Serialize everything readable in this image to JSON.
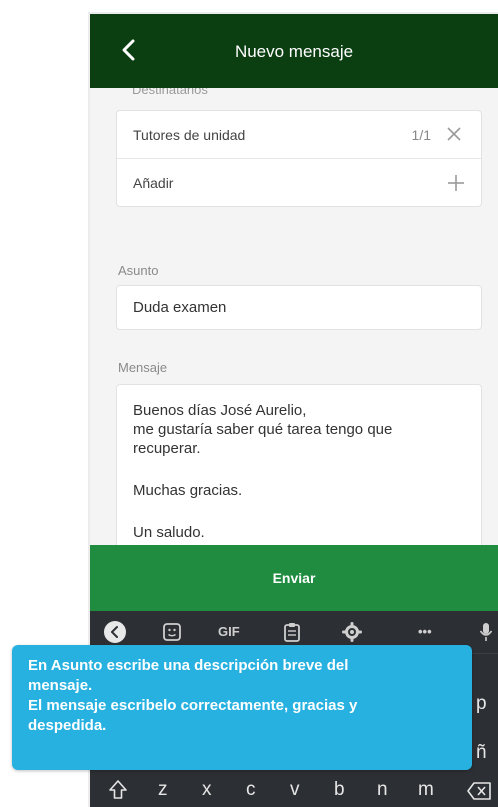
{
  "header": {
    "title": "Nuevo mensaje",
    "back_icon": "chevron-left-icon"
  },
  "form": {
    "recipients_label": "Destinatarios",
    "recipients": {
      "value": "Tutores de unidad",
      "count": "1/1",
      "add_label": "Añadir"
    },
    "subject_label": "Asunto",
    "subject_value": "Duda examen",
    "message_label": "Mensaje",
    "message_lines": [
      "Buenos días José Aurelio,",
      "me gustaría saber qué tarea tengo que",
      "recuperar.",
      "Muchas gracias.",
      "Un saludo."
    ]
  },
  "send_button": {
    "label": "Enviar"
  },
  "keyboard": {
    "toolbar": {
      "gif_label": "GIF",
      "more_label": "•••"
    },
    "side_keys": [
      "p",
      "ñ"
    ],
    "bottom_row": [
      "z",
      "x",
      "c",
      "v",
      "b",
      "n",
      "m"
    ]
  },
  "tooltip": {
    "lines": [
      "En Asunto escribe una descripción breve del",
      "mensaje.",
      "El mensaje escribelo correctamente, gracias y",
      "despedida."
    ]
  },
  "colors": {
    "header_bg": "#0b3f12",
    "send_bg": "#1f8c3f",
    "keyboard_bg": "#2c2f33",
    "tooltip_bg": "#27b1e1"
  }
}
